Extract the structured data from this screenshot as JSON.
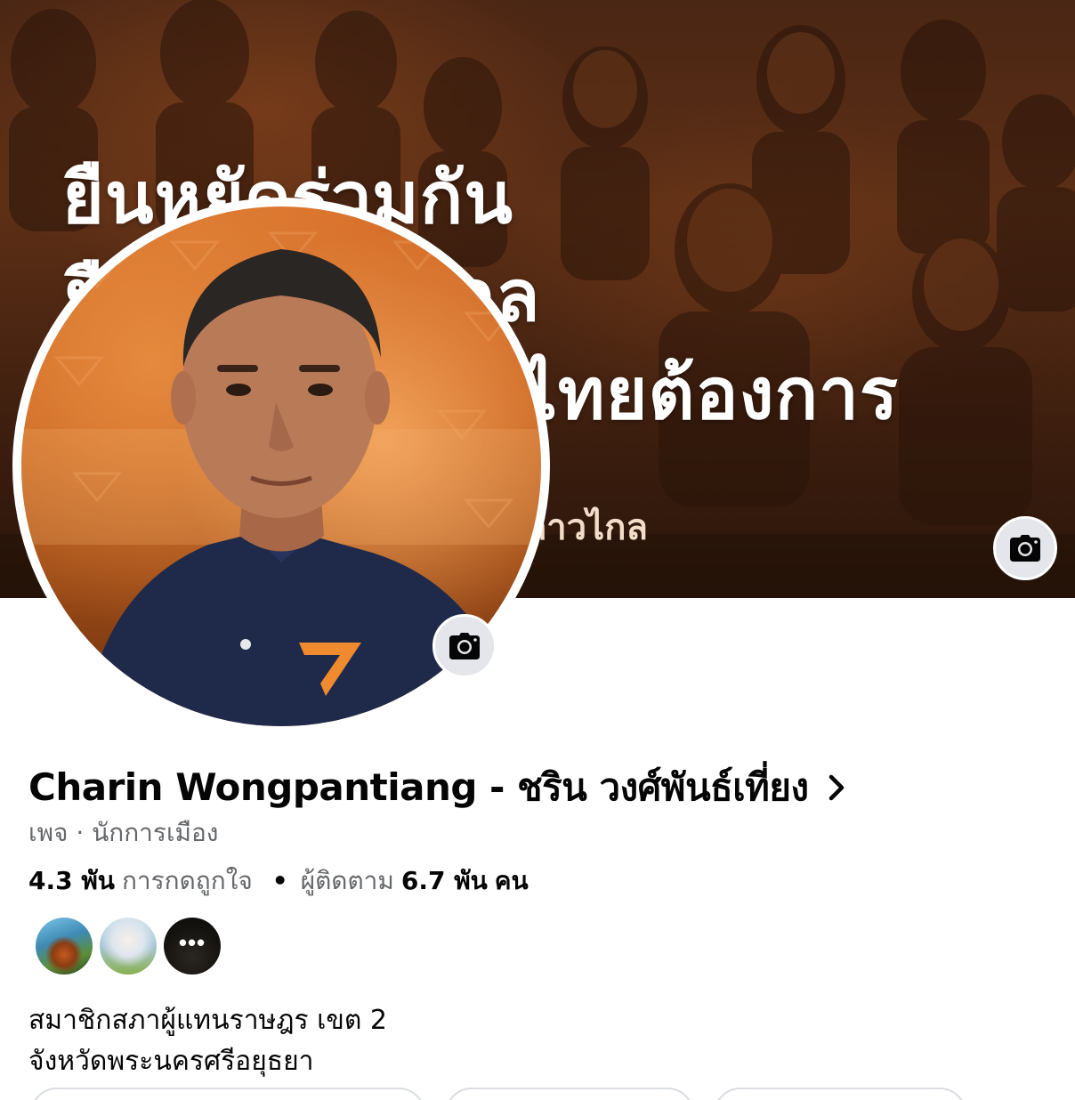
{
  "cover": {
    "headline_lines": [
      "ยืนหยัดร่วมกัน",
      "ยื",
      "นไทยต้องการ"
    ],
    "headline_line2_tail": "กล",
    "caption": "ก้าวไกล",
    "camera_icon": "camera-icon"
  },
  "avatar": {
    "camera_icon": "camera-icon"
  },
  "profile": {
    "name": "Charin Wongpantiang - ชริน วงศ์พันธ์เที่ยง",
    "subtitle": "เพจ · นักการเมือง",
    "likes_count": "4.3 พัน",
    "likes_label": "การกดถูกใจ",
    "dot": "•",
    "followers_label": "ผู้ติดตาม",
    "followers_count": "6.7 พัน",
    "followers_unit": "คน"
  },
  "friends": {
    "more_label": "•••"
  },
  "bio": {
    "line1": "สมาชิกสภาผู้แทนราษฎร เขต 2",
    "line2": "จังหวัดพระนครศรีอยุธยา"
  },
  "colors": {
    "primary_text": "#050505",
    "secondary_text": "#65676b",
    "camera_bg": "#e4e6eb",
    "cover_tint": "#5d2f16"
  }
}
